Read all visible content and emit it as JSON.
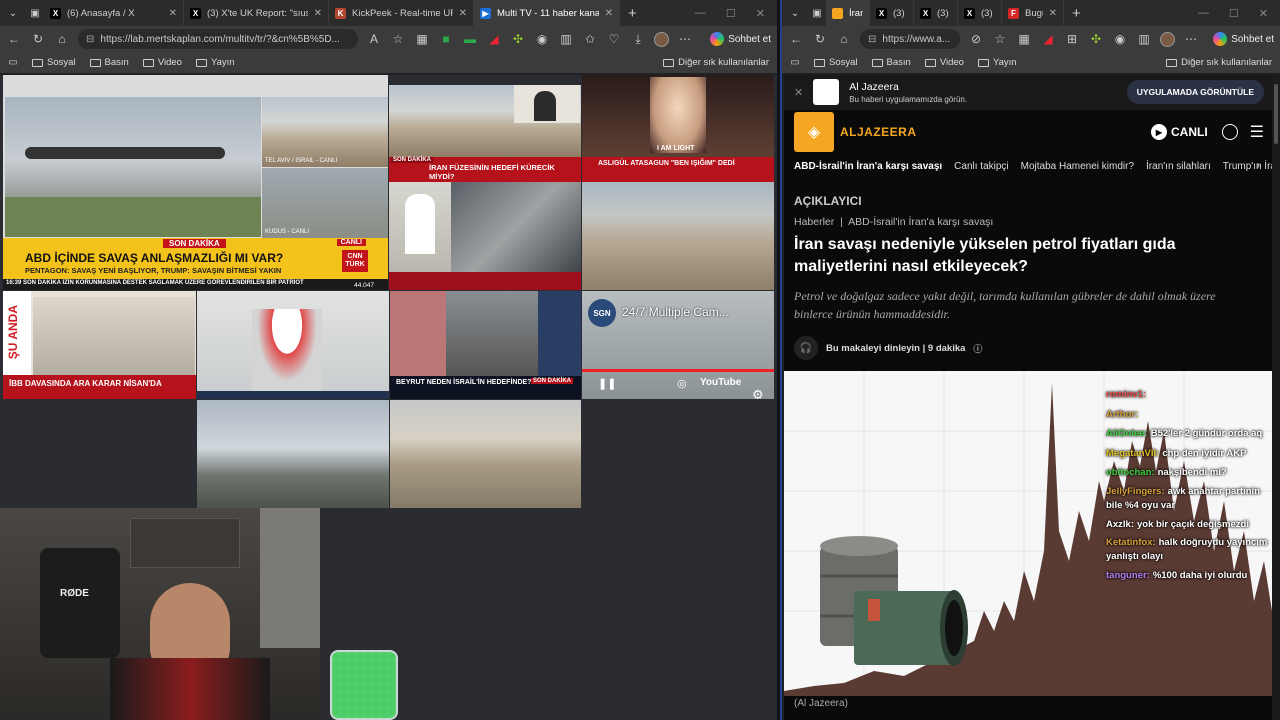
{
  "left_window": {
    "tabs": [
      {
        "title": "(6) Anasayfa / X",
        "icon": "x-logo-icon",
        "active": false
      },
      {
        "title": "(3) X'te UK Report: \"sıusu. — A",
        "icon": "x-logo-icon",
        "active": false
      },
      {
        "title": "KickPeek - Real-time URL Cra",
        "icon": "kickpeek-icon",
        "active": false
      },
      {
        "title": "Multi TV - 11 haber kanalını a",
        "icon": "multitv-icon",
        "active": true
      }
    ],
    "url": "https://lab.mertskaplan.com/multitv/tr/?&cn%5B%5D...",
    "chat_label": "Sohbet et",
    "bookmarks": [
      "Sosyal",
      "Basın",
      "Video",
      "Yayın"
    ],
    "bookmarks_other": "Diğer sık kullanılanlar",
    "tiles": {
      "cnn_label": "SON DAKİKA",
      "cnn_headline": "ABD İÇİNDE SAVAŞ ANLAŞMAZLIĞI MI VAR?",
      "cnn_sub": "PENTAGON: SAVAŞ YENİ BAŞLIYOR, TRUMP: SAVAŞIN BİTMESİ YAKIN",
      "cnn_ticker": "16:39  SON DAKİKA  İZİN KORUNMASINA DESTEK SAĞLAMAK ÜZERE GÖREVLENDİRİLEN BİR PATRİOT",
      "cnn_stock": "44.047",
      "cnn_live": "CANLI",
      "cnn_brand": "CNN TÜRK",
      "tlv_caption": "TEL AVIV / İSRAİL - CANLI",
      "kudus_caption": "KUDÜS - CANLI",
      "haber1_tag": "SON DAKİKA",
      "haber1_headline": "İRAN FÜZESİNİN HEDEFİ KÜRECİK MİYDİ?",
      "haber2_headline": "ASLIGÜL ATASAGUN \"BEN IŞIĞIM\" DEDİ",
      "haber2_overlay": "I AM LIGHT",
      "haber3_headline": "İBB DAVASINDA ARA KARAR NİSAN'DA",
      "haber3_side": "ŞU ANDA",
      "haber4_headline": "BEYRUT NEDEN İSRAİL'İN HEDEFİNDE?",
      "haber4_tag": "SON DAKİKA",
      "sgn_title": "24/7 Multiple Cam...",
      "sgn_logo": "SGN",
      "youtube": "YouTube"
    },
    "streamer": {
      "mic_brand": "RØDE"
    }
  },
  "right_window": {
    "tabs": [
      {
        "title": "İran sa",
        "icon": "aljazeera-icon",
        "active": true
      },
      {
        "title": "(3) X P",
        "icon": "x-logo-icon",
        "active": false
      },
      {
        "title": "(3) An",
        "icon": "x-logo-icon",
        "active": false
      },
      {
        "title": "(3) An",
        "icon": "x-logo-icon",
        "active": false
      },
      {
        "title": "Bugün",
        "icon": "flipboard-icon",
        "active": false
      }
    ],
    "url": "https://www.a...",
    "chat_label": "Sohbet et",
    "bookmarks": [
      "Sosyal",
      "Basın",
      "Video",
      "Yayın"
    ],
    "bookmarks_other": "Diğer sık kullanılanlar",
    "page": {
      "banner_title": "Al Jazeera",
      "banner_sub": "Bu haberi uygulamamızda görün.",
      "banner_button": "UYGULAMADA GÖRÜNTÜLE",
      "brand": "ALJAZEERA",
      "live": "CANLI",
      "nav": [
        "ABD-İsrail'in İran'a karşı savaşı",
        "Canlı takipçi",
        "Mojtaba Hamenei kimdir?",
        "İran'ın silahları",
        "Trump'ın İran'da"
      ],
      "kicker": "AÇIKLAYICI",
      "breadcrumb_1": "Haberler",
      "breadcrumb_sep": "|",
      "breadcrumb_2": "ABD-İsrail'in İran'a karşı savaşı",
      "headline": "İran savaşı nedeniyle yükselen petrol fiyatları gıda maliyetlerini nasıl etkileyecek?",
      "dek": "Petrol ve doğalgaz sadece yakıt değil, tarımda kullanılan gübreler de dahil olmak üzere binlerce ürünün hammaddesidir.",
      "listen": "Bu makaleyi dinleyin | 9 dakika",
      "caption": "(Al Jazeera)"
    },
    "chat_overlay": [
      {
        "user": "rominv1:",
        "msg": "",
        "color": "#e84b4b"
      },
      {
        "user": "Arthor:",
        "msg": "",
        "color": "#d7a13a"
      },
      {
        "user": "AliOnlee:",
        "msg": "B52'ler 2 gündür orda aq",
        "color": "#3fcf3f"
      },
      {
        "user": "MegatanVII:",
        "msg": "chp den iyidir AKP",
        "color": "#e1c226"
      },
      {
        "user": "obitochan:",
        "msg": "nakşibendi mi?",
        "color": "#3fcf3f"
      },
      {
        "user": "JellyFingers:",
        "msg": "awk anahtar partinin bile %4 oyu var",
        "color": "#d7a13a"
      },
      {
        "user": "Axzlk:",
        "msg": "yok bir çaçık değişmezdi",
        "color": "#ffffff"
      },
      {
        "user": "Ketatinfox:",
        "msg": "halk doğruydu yayıncım yanlıştı olayı",
        "color": "#d7a13a"
      },
      {
        "user": "tanguner:",
        "msg": "%100 daha iyi olurdu",
        "color": "#b57cf0"
      }
    ]
  }
}
